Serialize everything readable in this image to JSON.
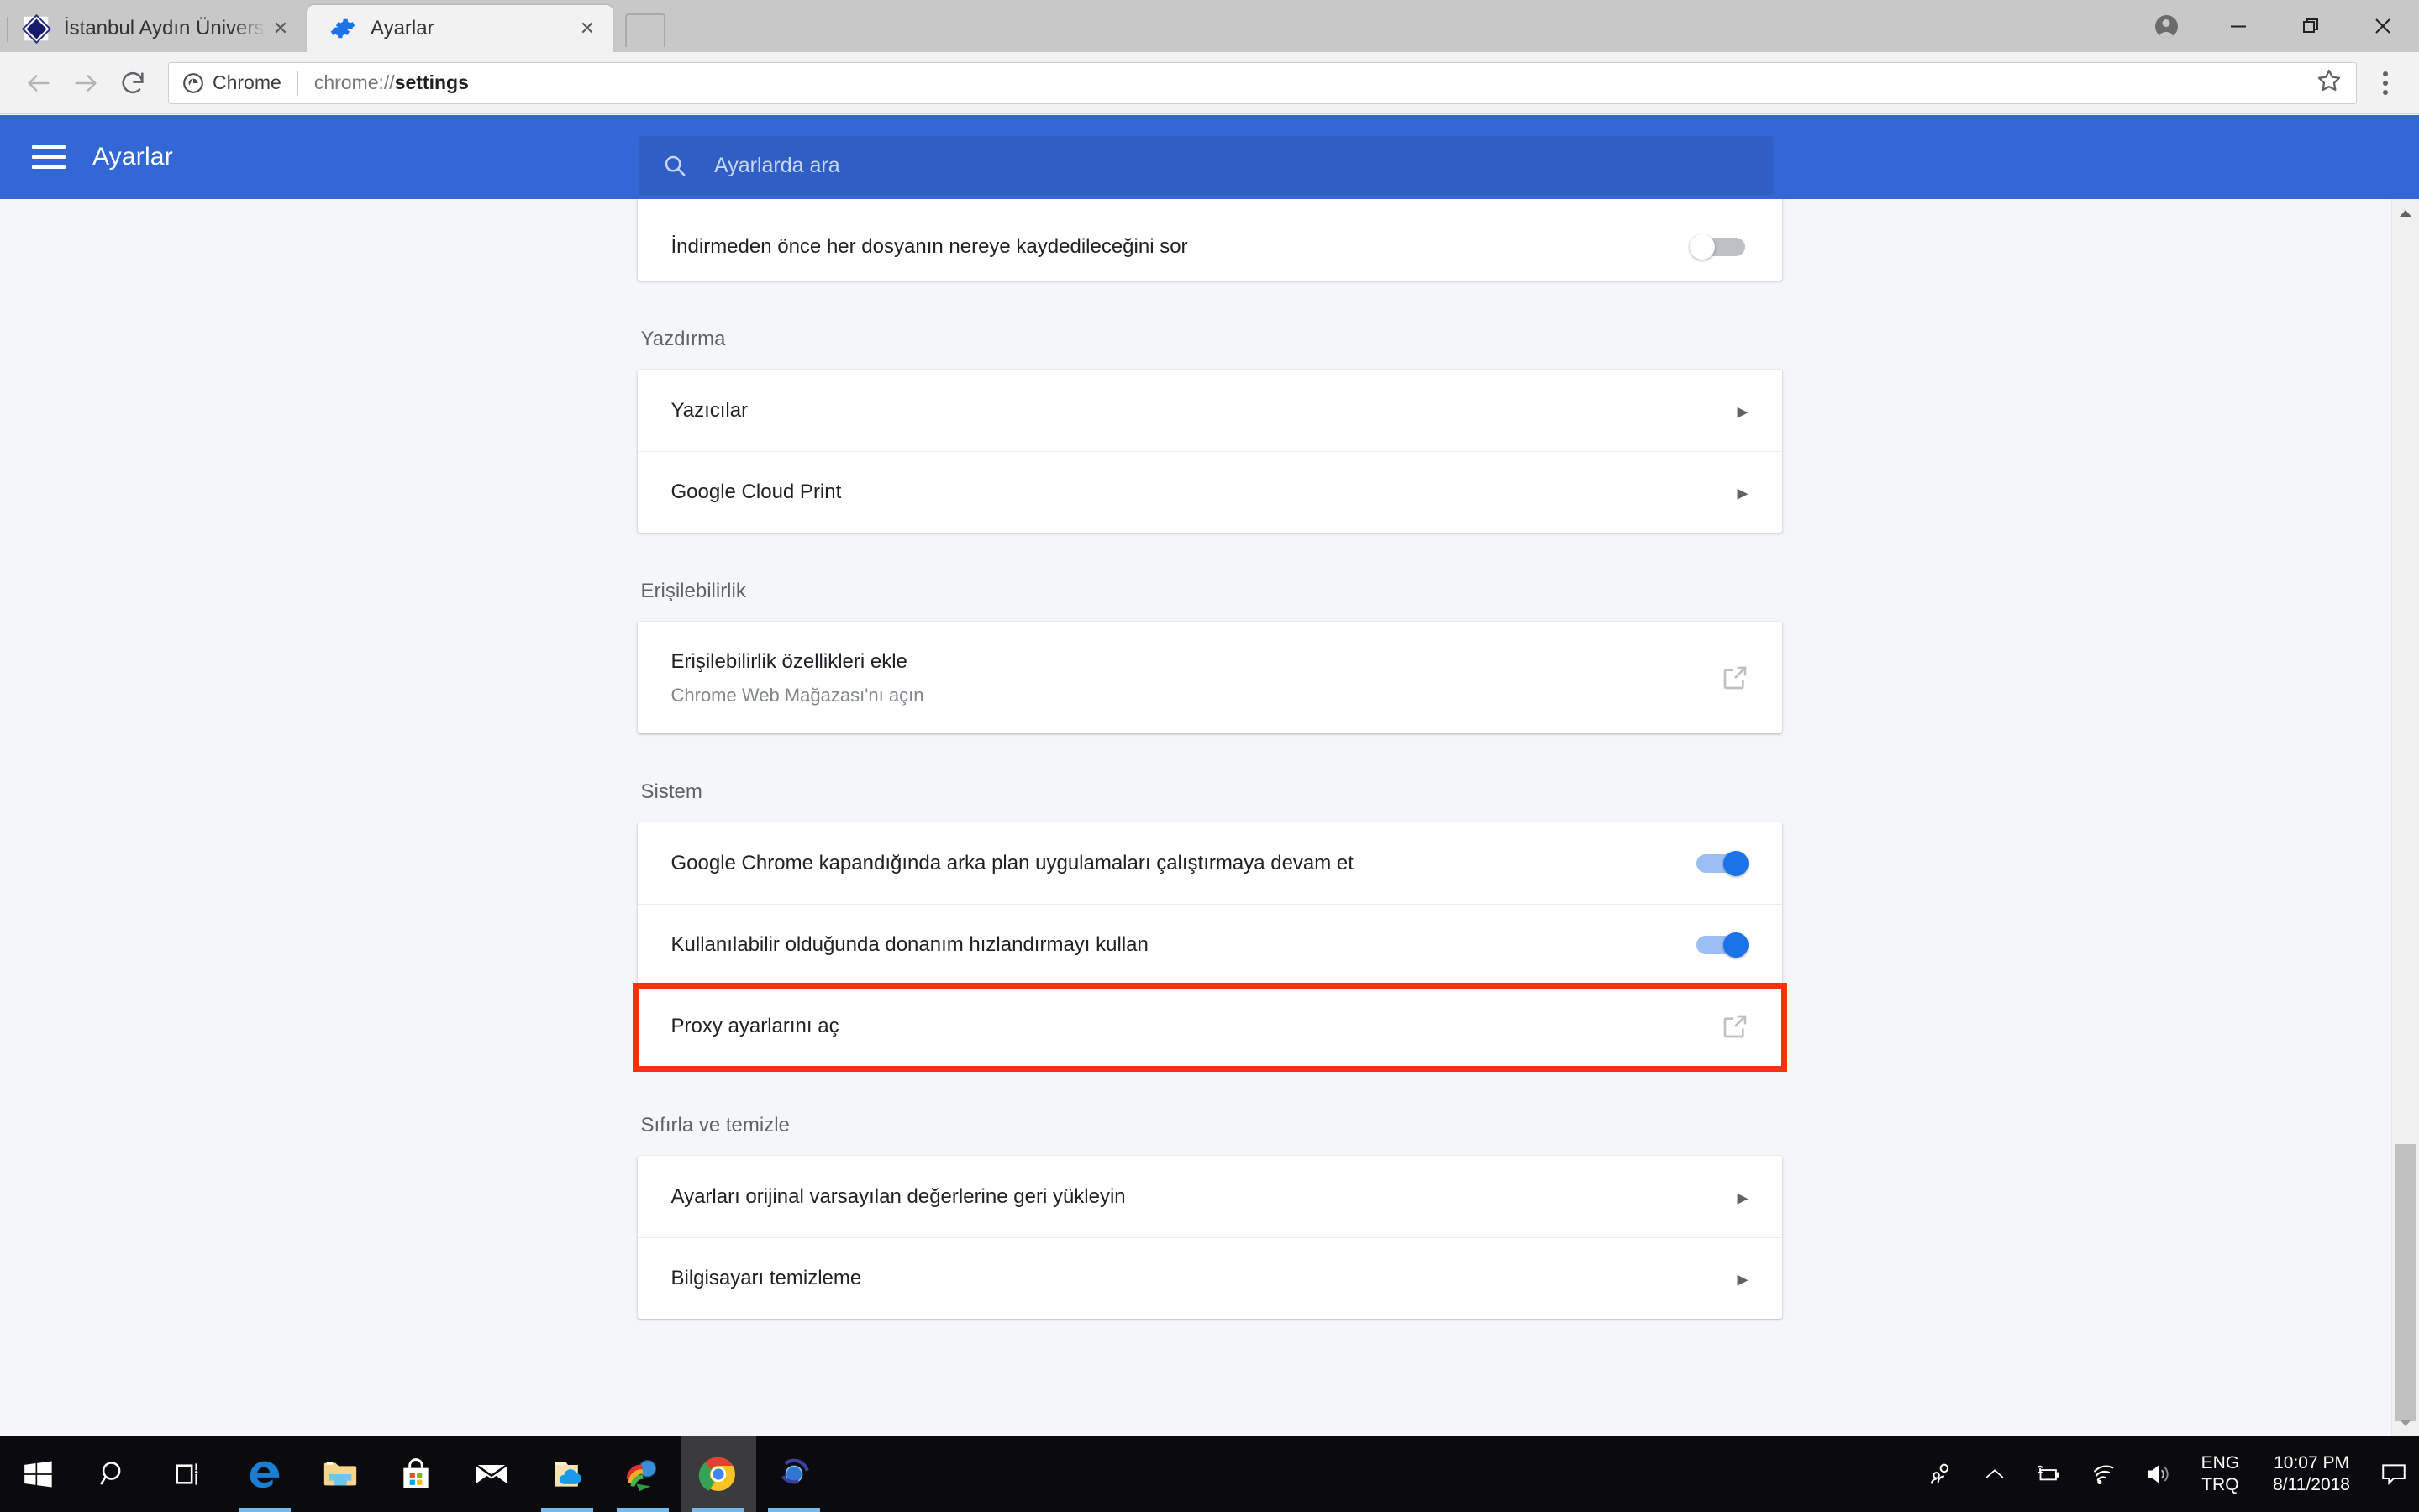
{
  "browser": {
    "tabs": [
      {
        "title": "İstanbul Aydın Üniversitesi",
        "favicon": "iau-diamond-icon",
        "active": false
      },
      {
        "title": "Ayarlar",
        "favicon": "gear-icon",
        "active": true
      }
    ],
    "new_tab_label": "",
    "window_controls": {
      "profile": "profile-avatar-icon",
      "minimize": "—",
      "maximize": "restore-icon",
      "close": "✕"
    },
    "toolbar": {
      "back": "back-arrow-icon",
      "forward": "forward-arrow-icon",
      "reload": "reload-icon",
      "omnibox_chip": "Chrome",
      "omnibox_url_prefix": "chrome://",
      "omnibox_url_bold": "settings",
      "bookmark": "star-icon",
      "menu": "three-dots-icon"
    }
  },
  "settings": {
    "title": "Ayarlar",
    "menu_icon": "hamburger-icon",
    "search": {
      "placeholder": "Ayarlarda ara",
      "icon": "search-icon",
      "value": ""
    },
    "top_partial_row": {
      "label": "İndirmeden önce her dosyanın nereye kaydedileceğini sor",
      "toggle": "off"
    },
    "sections": [
      {
        "name": "Yazdırma",
        "rows": [
          {
            "label": "Yazıcılar",
            "control": "chevron"
          },
          {
            "label": "Google Cloud Print",
            "control": "chevron"
          }
        ]
      },
      {
        "name": "Erişilebilirlik",
        "rows": [
          {
            "label": "Erişilebilirlik özellikleri ekle",
            "sub": "Chrome Web Mağazası'nı açın",
            "control": "external-link"
          }
        ]
      },
      {
        "name": "Sistem",
        "rows": [
          {
            "label": "Google Chrome kapandığında arka plan uygulamaları çalıştırmaya devam et",
            "control": "toggle-on"
          },
          {
            "label": "Kullanılabilir olduğunda donanım hızlandırmayı kullan",
            "control": "toggle-on"
          },
          {
            "label": "Proxy ayarlarını aç",
            "control": "external-link",
            "highlighted": true
          }
        ]
      },
      {
        "name": "Sıfırla ve temizle",
        "rows": [
          {
            "label": "Ayarları orijinal varsayılan değerlerine geri yükleyin",
            "control": "chevron"
          },
          {
            "label": "Bilgisayarı temizleme",
            "control": "chevron"
          }
        ]
      }
    ]
  },
  "colors": {
    "header_blue": "#3367d6",
    "search_blue": "#2f5fc4",
    "toggle_on": "#1a73e8",
    "toggle_on_track": "#9dbdf5",
    "toggle_off_track": "#bdc1c6",
    "highlight_red": "#f4320c",
    "page_bg": "#f5f6f8",
    "taskbar_bg": "#0b0b0d"
  },
  "taskbar": {
    "items": [
      {
        "name": "start-button",
        "icon": "windows-logo-icon",
        "active": false,
        "running": false
      },
      {
        "name": "search-button",
        "icon": "search-icon",
        "active": false,
        "running": false
      },
      {
        "name": "task-view-button",
        "icon": "task-view-icon",
        "active": false,
        "running": false
      },
      {
        "name": "edge-button",
        "icon": "edge-icon",
        "active": false,
        "running": true
      },
      {
        "name": "file-explorer-button",
        "icon": "folder-icon",
        "active": false,
        "running": false
      },
      {
        "name": "microsoft-store-button",
        "icon": "store-bag-icon",
        "active": false,
        "running": false
      },
      {
        "name": "mail-button",
        "icon": "mail-envelope-icon",
        "active": false,
        "running": false
      },
      {
        "name": "onedrive-folder-button",
        "icon": "onedrive-folder-icon",
        "active": false,
        "running": true
      },
      {
        "name": "internet-download-manager-button",
        "icon": "idm-icon",
        "active": false,
        "running": true
      },
      {
        "name": "chrome-button",
        "icon": "chrome-icon",
        "active": true,
        "running": true
      },
      {
        "name": "app-button",
        "icon": "globe-orbit-icon",
        "active": false,
        "running": true
      }
    ],
    "tray": {
      "people": "people-icon",
      "show_hidden": "chevron-up-icon",
      "battery": "battery-charging-icon",
      "network": "wifi-icon",
      "volume": "speaker-icon",
      "language_line1": "ENG",
      "language_line2": "TRQ",
      "time": "10:07 PM",
      "date": "8/11/2018",
      "action_center": "notification-icon"
    }
  }
}
